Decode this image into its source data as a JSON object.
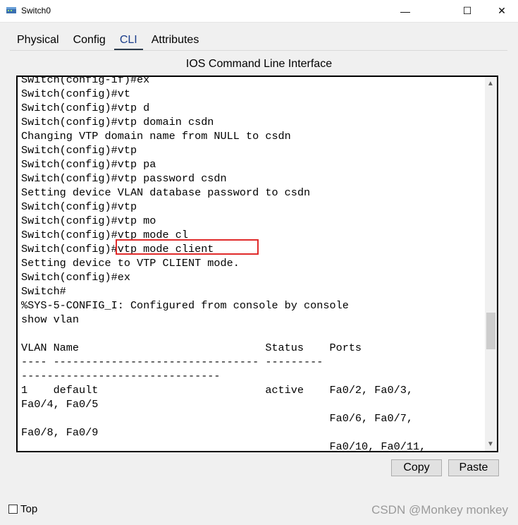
{
  "window": {
    "title": "Switch0",
    "minimize": "—",
    "maximize": "☐",
    "close": "✕"
  },
  "tabs": [
    {
      "label": "Physical"
    },
    {
      "label": "Config"
    },
    {
      "label": "CLI"
    },
    {
      "label": "Attributes"
    }
  ],
  "active_tab": "CLI",
  "panel_title": "IOS Command Line Interface",
  "cli": {
    "lines": [
      "Switch(config-if)#ex",
      "Switch(config)#vt",
      "Switch(config)#vtp d",
      "Switch(config)#vtp domain csdn",
      "Changing VTP domain name from NULL to csdn",
      "Switch(config)#vtp",
      "Switch(config)#vtp pa",
      "Switch(config)#vtp password csdn",
      "Setting device VLAN database password to csdn",
      "Switch(config)#vtp",
      "Switch(config)#vtp mo",
      "Switch(config)#vtp mode cl",
      "Switch(config)#vtp mode client",
      "Setting device to VTP CLIENT mode.",
      "Switch(config)#ex",
      "Switch#",
      "%SYS-5-CONFIG_I: Configured from console by console",
      "show vlan",
      "",
      "VLAN Name                             Status    Ports",
      "---- -------------------------------- ---------",
      "-------------------------------",
      "1    default                          active    Fa0/2, Fa0/3,",
      "Fa0/4, Fa0/5",
      "                                                Fa0/6, Fa0/7,",
      "Fa0/8, Fa0/9",
      "                                                Fa0/10, Fa0/11,"
    ]
  },
  "buttons": {
    "copy": "Copy",
    "paste": "Paste"
  },
  "top_checkbox": {
    "label": "Top",
    "checked": false
  },
  "watermark": "CSDN @Monkey monkey",
  "colors": {
    "highlight": "#e02b2b",
    "active_tab_underline": "#2b3a4a"
  }
}
